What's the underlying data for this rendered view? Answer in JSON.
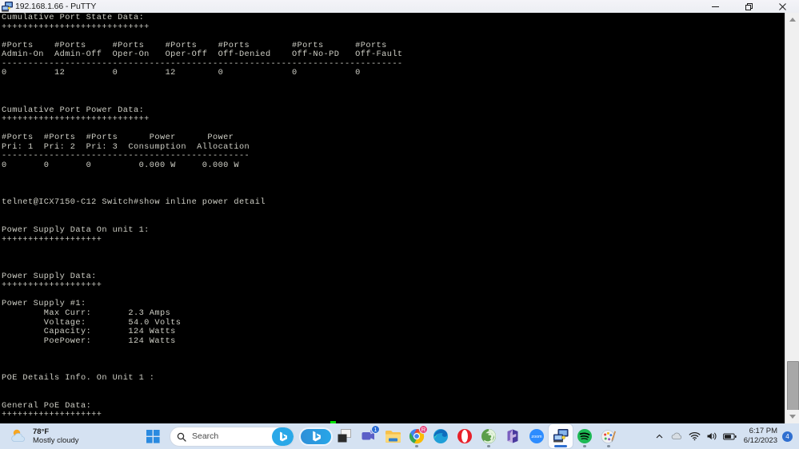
{
  "window": {
    "title": "192.168.1.66 - PuTTY",
    "icon": "putty-computer-icon",
    "controls": {
      "minimize": "minimize-icon",
      "restore": "restore-icon",
      "close": "close-icon"
    }
  },
  "terminal": {
    "foreground_color": "#cfcfc6",
    "background_color": "#000000",
    "cursor_color": "#00e000",
    "cursor_char": "block",
    "content": "Cumulative Port State Data:\n++++++++++++++++++++++++++++\n\n#Ports    #Ports     #Ports    #Ports    #Ports        #Ports      #Ports\nAdmin-On  Admin-Off  Oper-On   Oper-Off  Off-Denied    Off-No-PD   Off-Fault\n----------------------------------------------------------------------------\n0         12         0         12        0             0           0\n\n\n\nCumulative Port Power Data:\n++++++++++++++++++++++++++++\n\n#Ports  #Ports  #Ports      Power      Power\nPri: 1  Pri: 2  Pri: 3  Consumption  Allocation\n-----------------------------------------------\n0       0       0         0.000 W     0.000 W\n\n\n\ntelnet@ICX7150-C12 Switch#show inline power detail\n\n\nPower Supply Data On unit 1:\n+++++++++++++++++++\n\n\n\nPower Supply Data:\n+++++++++++++++++++\n\nPower Supply #1:\n        Max Curr:       2.3 Amps\n        Voltage:        54.0 Volts\n        Capacity:       124 Watts\n        PoePower:       124 Watts\n\n\n\nPOE Details Info. On Unit 1 :\n\n\nGeneral PoE Data:\n+++++++++++++++++++\n\n--More--, next page: Space, next line: Return key, quit: Control-c"
  },
  "scrollbar": {
    "up_arrow": "scroll-up-arrow",
    "down_arrow": "scroll-down-arrow",
    "thumb_position_percent": 86
  },
  "taskbar": {
    "weather": {
      "temperature": "78°F",
      "condition": "Mostly cloudy",
      "icon": "sun-cloud-icon"
    },
    "start_button": "windows-start-icon",
    "search": {
      "placeholder": "Search",
      "icon": "search-icon",
      "bing_button_icon": "bing-icon"
    },
    "apps": [
      {
        "name": "bing-chat",
        "icon": "bing-icon",
        "badge": null,
        "active": false,
        "running": false
      },
      {
        "name": "task-view",
        "icon": "task-view-icon",
        "badge": null,
        "active": false,
        "running": false
      },
      {
        "name": "microsoft-teams",
        "icon": "teams-icon",
        "badge": "1",
        "badge_color": "#2b6cd4",
        "active": false,
        "running": false
      },
      {
        "name": "file-explorer",
        "icon": "folder-icon",
        "badge": null,
        "active": false,
        "running": false
      },
      {
        "name": "google-chrome",
        "icon": "chrome-icon",
        "badge": "R",
        "badge_color": "#e8447e",
        "active": false,
        "running": true
      },
      {
        "name": "microsoft-edge",
        "icon": "edge-icon",
        "badge": null,
        "active": false,
        "running": false
      },
      {
        "name": "opera-browser",
        "icon": "opera-icon",
        "badge": null,
        "active": false,
        "running": false
      },
      {
        "name": "spiral-app",
        "icon": "spiral-icon",
        "badge": null,
        "active": false,
        "running": true
      },
      {
        "name": "microsoft-365",
        "icon": "microsoft-365-icon",
        "badge": null,
        "active": false,
        "running": false
      },
      {
        "name": "zoom",
        "icon": "zoom-icon",
        "label": "zoom",
        "badge": null,
        "active": false,
        "running": false
      },
      {
        "name": "putty",
        "icon": "putty-computer-icon",
        "badge": null,
        "active": true,
        "running": true
      },
      {
        "name": "spotify",
        "icon": "spotify-icon",
        "badge": null,
        "active": false,
        "running": true
      },
      {
        "name": "paint",
        "icon": "paint-icon",
        "badge": null,
        "active": false,
        "running": true
      }
    ],
    "tray": {
      "chevron": "chevron-up-icon",
      "onedrive": "cloud-icon",
      "network": "wifi-icon",
      "volume": "speaker-icon",
      "battery": "battery-icon",
      "time": "6:17 PM",
      "date": "6/12/2023",
      "notification_count": "4"
    }
  }
}
